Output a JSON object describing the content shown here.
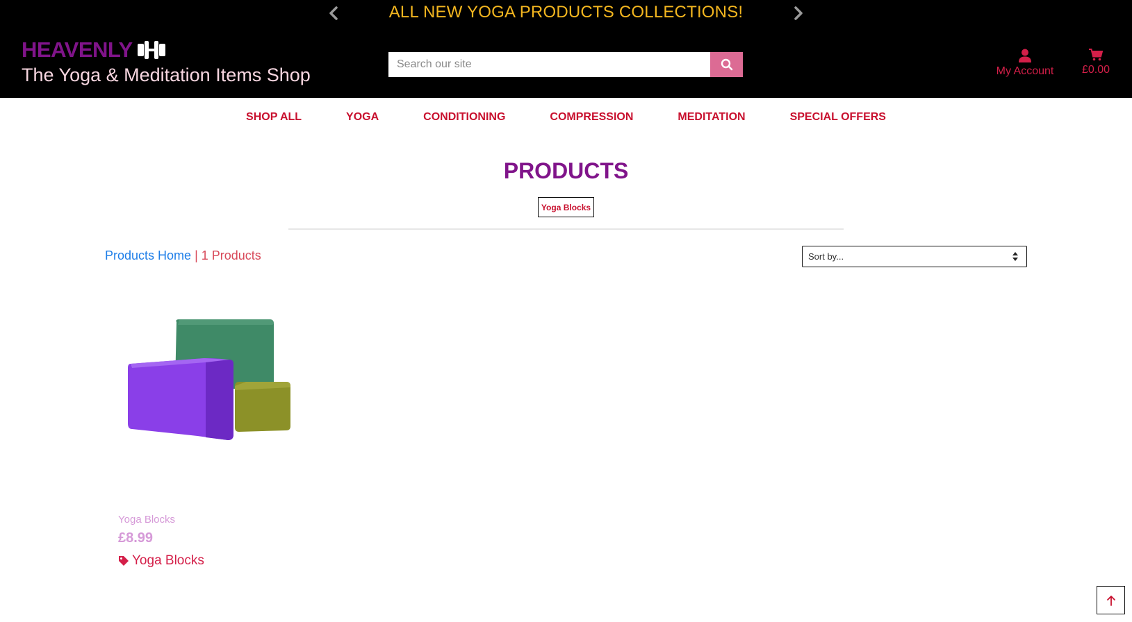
{
  "banner": {
    "text": "ALL NEW YOGA PRODUCTS COLLECTIONS!"
  },
  "brand": {
    "name": "HEAVENLY",
    "tagline": "The Yoga & Meditation Items Shop"
  },
  "search": {
    "placeholder": "Search our site"
  },
  "account": {
    "label": "My Account"
  },
  "cart": {
    "total": "£0.00"
  },
  "nav": {
    "items": [
      {
        "label": "SHOP ALL"
      },
      {
        "label": "YOGA"
      },
      {
        "label": "CONDITIONING"
      },
      {
        "label": "COMPRESSION"
      },
      {
        "label": "MEDITATION"
      },
      {
        "label": "SPECIAL OFFERS"
      }
    ]
  },
  "page": {
    "title": "PRODUCTS",
    "category_tag": "Yoga Blocks",
    "breadcrumb_home": "Products Home",
    "breadcrumb_sep": " | ",
    "product_count": "1 Products",
    "sort_placeholder": "Sort by..."
  },
  "products": [
    {
      "name": "Yoga Blocks",
      "price": "£8.99",
      "category": "Yoga Blocks"
    }
  ],
  "colors": {
    "header_bg": "#000000",
    "banner": "#f3b61f",
    "brand": "#80148a",
    "accent": "#d41f49",
    "search_button": "#dc6b94"
  }
}
